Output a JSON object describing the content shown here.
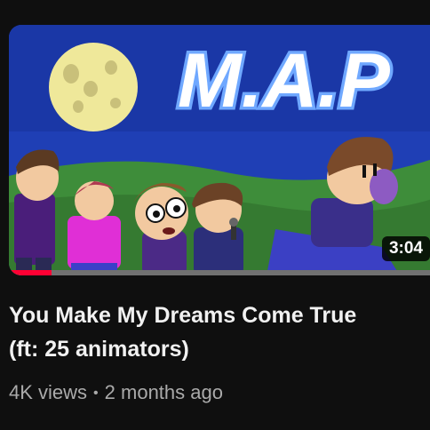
{
  "video": {
    "duration": "3:04",
    "watch_progress": 0.1,
    "title_line1": "You Make My Dreams Come True",
    "title_line2": "(ft: 25 animators)",
    "views": "4K views",
    "separator": "•",
    "uploaded": "2 months ago"
  },
  "thumbnail": {
    "logo_text": "M.A.P",
    "colors": {
      "sky": "#1f3fb5",
      "grass": "#3e8d3a",
      "moon": "#efe89a",
      "logo_fill": "#ffffff",
      "logo_stroke": "#6fa8ff",
      "progress": "#ff0033"
    }
  }
}
